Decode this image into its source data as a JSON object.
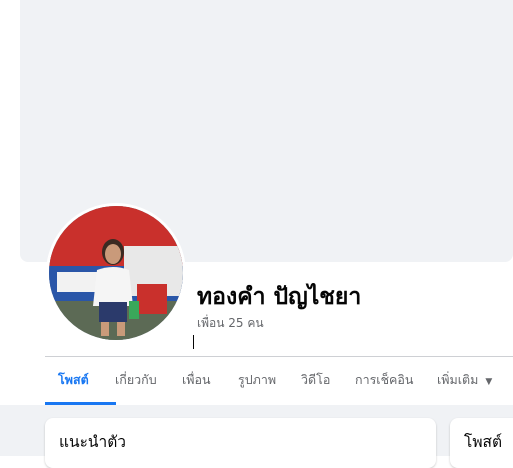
{
  "profile": {
    "name": "ทองคำ ปัญไชยา",
    "friends": "เพื่อน 25 คน"
  },
  "tabs": [
    {
      "label": "โพสต์",
      "active": true
    },
    {
      "label": "เกี่ยวกับ"
    },
    {
      "label": "เพื่อน"
    },
    {
      "label": "รูปภาพ"
    },
    {
      "label": "วิดีโอ"
    },
    {
      "label": "การเช็คอิน"
    },
    {
      "label": "เพิ่มเติม"
    }
  ],
  "cards": {
    "intro_title": "แนะนำตัว",
    "posts_title": "โพสต์"
  },
  "colors": {
    "accent": "#1877f2",
    "background": "#f0f2f5",
    "secondary_text": "#65676b"
  }
}
